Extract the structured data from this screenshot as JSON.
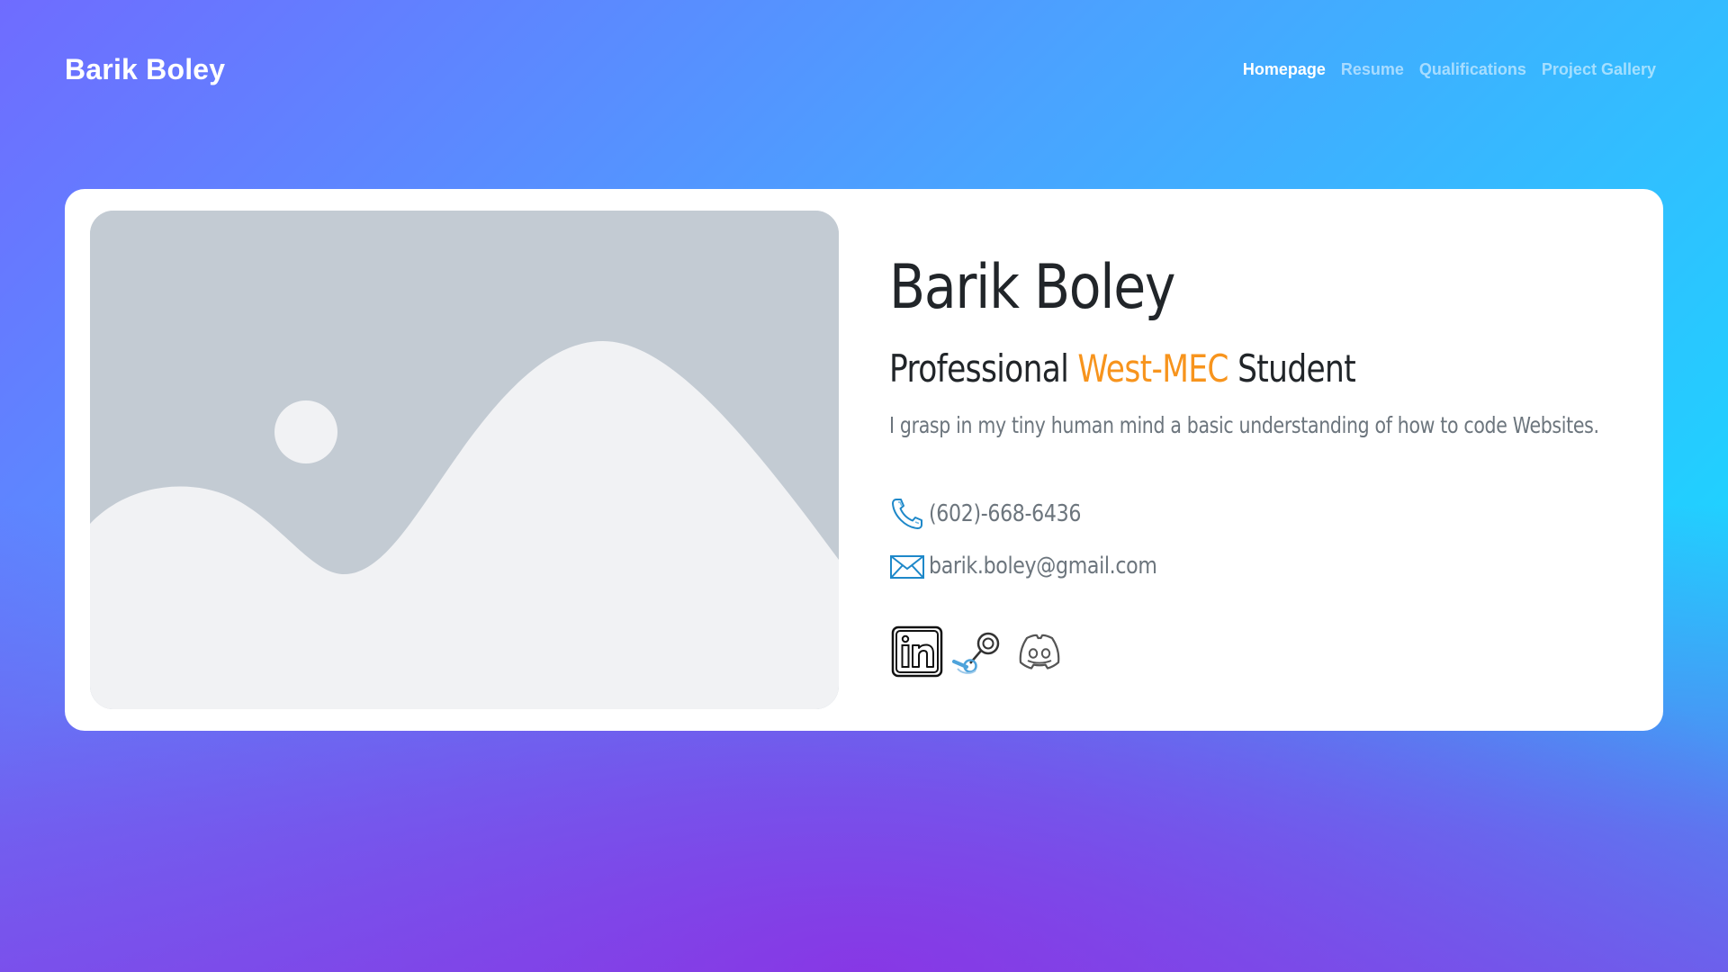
{
  "navbar": {
    "brand": "Barik Boley",
    "links": [
      {
        "label": "Homepage",
        "active": true
      },
      {
        "label": "Resume",
        "active": false
      },
      {
        "label": "Qualifications",
        "active": false
      },
      {
        "label": "Project Gallery",
        "active": false
      }
    ]
  },
  "profile": {
    "image_icon": "image-placeholder-icon",
    "name": "Barik Boley",
    "subtitle": {
      "prefix": "Professional",
      "highlight": "West-MEC",
      "suffix": "Student"
    },
    "tagline": "I grasp in my tiny human mind a basic understanding of how to code Websites.",
    "phone": "(602)-668-6436",
    "email": "barik.boley@gmail.com",
    "socials": [
      {
        "icon": "linkedin-icon"
      },
      {
        "icon": "steam-icon"
      },
      {
        "icon": "discord-icon"
      }
    ]
  },
  "colors": {
    "accent": "#f7941d",
    "heading": "#212529",
    "muted_text": "#6c757d",
    "contact_icon": "#1e88c9"
  }
}
